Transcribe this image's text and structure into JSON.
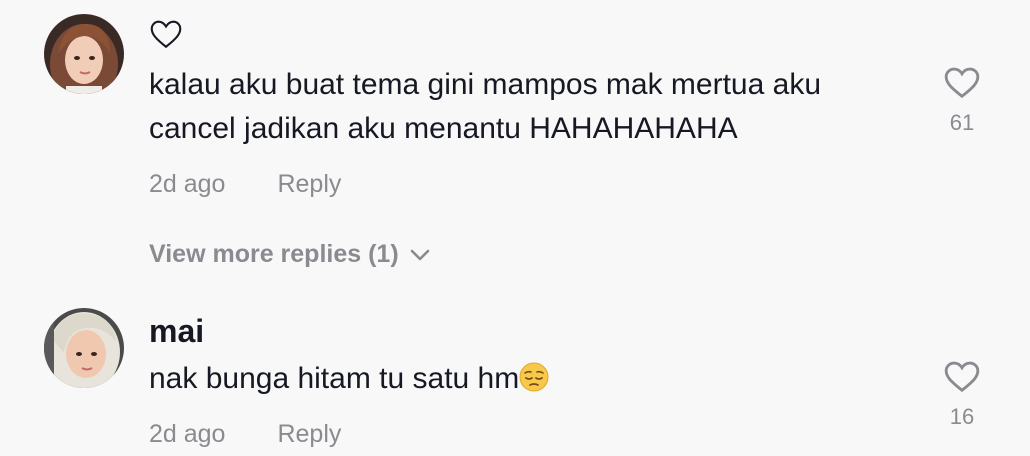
{
  "comments": [
    {
      "username": "",
      "username_icon": "heart-outline-icon",
      "text": "kalau aku buat tema gini mampos mak mertua aku cancel jadikan aku menantu HAHAHAHAHA",
      "time": "2d ago",
      "reply_label": "Reply",
      "like_count": "61",
      "view_more_label": "View more replies (1)"
    },
    {
      "username": "mai",
      "text": "nak bunga hitam tu satu hm",
      "emoji": "pensive-face",
      "time": "2d ago",
      "reply_label": "Reply",
      "like_count": "16"
    }
  ],
  "colors": {
    "background": "#f8f8f8",
    "text": "#161823",
    "secondary": "#8a8b91"
  }
}
